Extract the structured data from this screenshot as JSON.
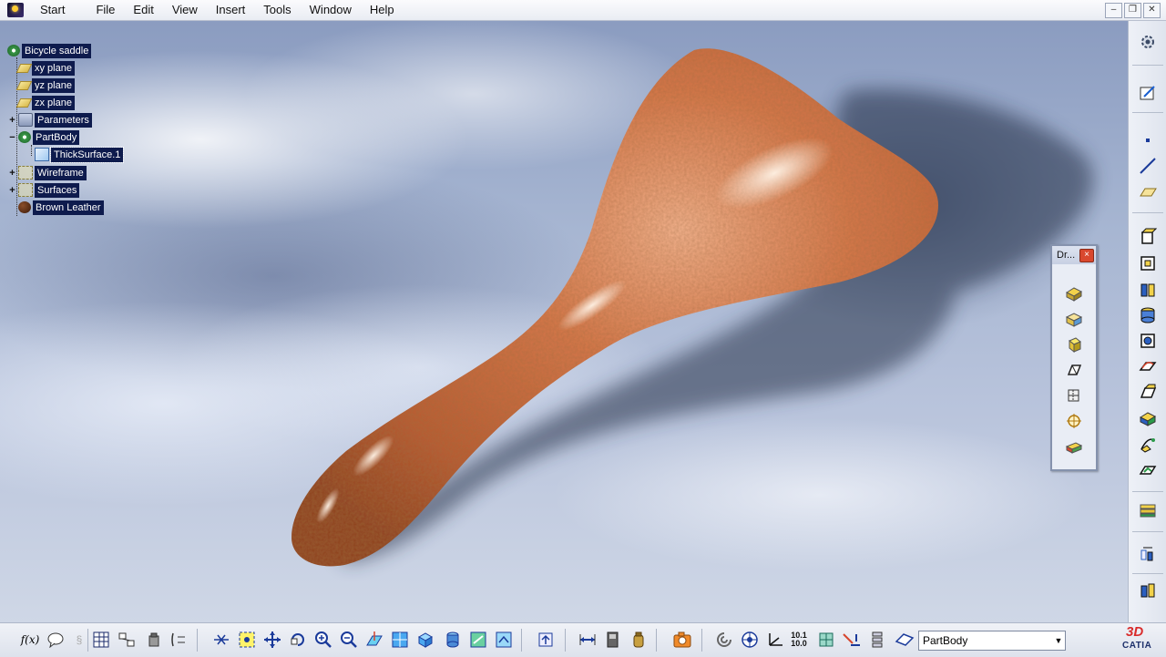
{
  "menubar": {
    "items": [
      "Start",
      "File",
      "Edit",
      "View",
      "Insert",
      "Tools",
      "Window",
      "Help"
    ],
    "window_controls": [
      "minimize",
      "restore",
      "close"
    ]
  },
  "tree": {
    "root": "Bicycle saddle",
    "planes": [
      "xy plane",
      "yz plane",
      "zx plane"
    ],
    "parameters": "Parameters",
    "partbody": "PartBody",
    "thick_surface": "ThickSurface.1",
    "wireframe": "Wireframe",
    "surfaces": "Surfaces",
    "material": "Brown Leather"
  },
  "floating_toolbar": {
    "title": "Dr...",
    "tools": [
      "draft-analysis-icon",
      "draft-reflect-icon",
      "draft-variable-icon",
      "draft-chamfer-icon",
      "draft-parting-icon",
      "draft-target-icon",
      "draft-box-icon"
    ]
  },
  "right_toolbar": {
    "tools": [
      "settings-gear-icon",
      "sketcher-icon",
      "point-icon",
      "line-icon",
      "plane-icon",
      "pad-icon",
      "pocket-icon",
      "shaft-icon",
      "groove-icon",
      "hole-icon",
      "rib-icon",
      "slot-icon",
      "stiffener-icon",
      "loft-icon",
      "remove-loft-icon",
      "thickness-icon",
      "translate-icon",
      "union-icon"
    ]
  },
  "bottom_toolbar": {
    "formula_label": "f(x)",
    "dim_label_top": "10.1",
    "dim_label_bottom": "10.0",
    "current_body": "PartBody"
  },
  "brand": {
    "logo_text": "CATIA",
    "mark_text": "3D"
  },
  "colors": {
    "tree_highlight": "#0e1b4d",
    "leather": "#c8673e"
  }
}
